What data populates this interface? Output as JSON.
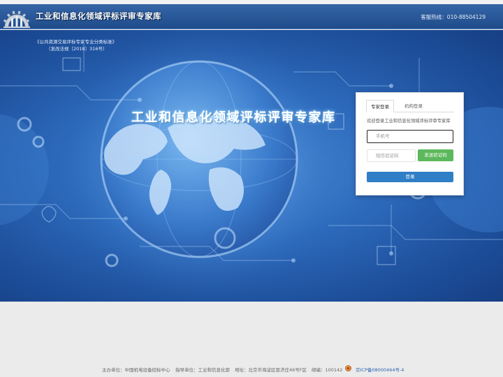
{
  "header": {
    "title": "工业和信息化领域评标评审专家库",
    "hotline": "客服热线：010-88504129"
  },
  "hero": {
    "policy_line1": "《公共资源交易评标专家专业分类标准》",
    "policy_line2": "（发改法规〔2018〕316号）",
    "title": "工业和信息化领域评标评审专家库"
  },
  "login": {
    "tab_expert": "专家登录",
    "tab_org": "机构登录",
    "welcome": "欢迎登录工业和信息化领域评标评审专家库",
    "phone_placeholder": "手机号",
    "code_placeholder": "短信验证码",
    "send_code": "发送验证码",
    "submit": "登录"
  },
  "footer": {
    "host": "主办单位：中国机电设备招标中心",
    "guide": "指导单位：工业和信息化部",
    "address": "地址：北京市海淀区恩济庄46号F区",
    "zip": "邮编：100142",
    "icp": "京ICP备08000464号-4"
  },
  "colors": {
    "header": "#2a5a9c",
    "hero": "#2e6bbd",
    "send_code": "#5cb85c",
    "login_button": "#2f7ec6",
    "icp_link": "#2e62b0"
  },
  "icons": [
    "gear-logo-icon",
    "police-emblem-icon"
  ]
}
